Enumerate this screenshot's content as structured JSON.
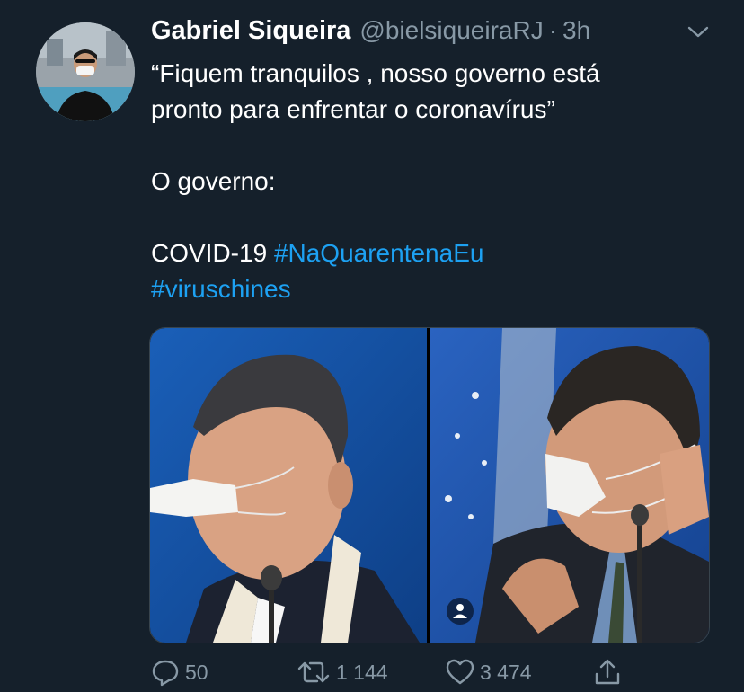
{
  "tweet": {
    "author_name": "Gabriel Siqueira",
    "handle": "@bielsiqueiraRJ",
    "separator": "·",
    "time": "3h",
    "text_lines": [
      "“Fiquem tranquilos , nosso governo está",
      "pronto para enfrentar o coronavírus”",
      "O governo:",
      "COVID-19"
    ],
    "hashtags": [
      "#NaQuarentenaEu",
      "#viruschines"
    ]
  },
  "actions": {
    "replies": "50",
    "retweets": "1 144",
    "likes": "3 474"
  },
  "icons": {
    "menu": "chevron-down-icon",
    "reply": "reply-icon",
    "retweet": "retweet-icon",
    "like": "heart-icon",
    "share": "share-icon",
    "media_person": "person-icon"
  },
  "colors": {
    "background": "#15202b",
    "text": "#ffffff",
    "secondary": "#8899a6",
    "link": "#1da1f2"
  }
}
